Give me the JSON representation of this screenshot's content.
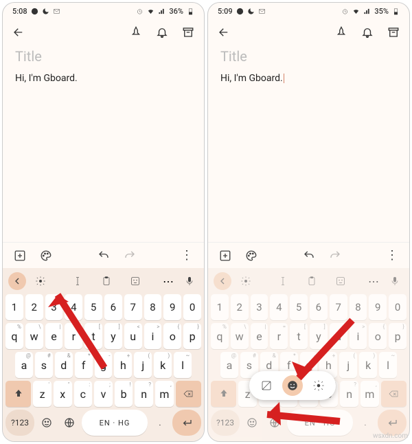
{
  "status": {
    "time_left": "5:08",
    "time_right": "5:09",
    "battery_left": "36%",
    "battery_right": "35%"
  },
  "editor": {
    "title_placeholder": "Title",
    "body": "Hi, I'm Gboard."
  },
  "keyboard": {
    "row_nums": [
      "1",
      "2",
      "3",
      "4",
      "5",
      "6",
      "7",
      "8",
      "9",
      "0"
    ],
    "row1": [
      "q",
      "w",
      "e",
      "r",
      "t",
      "y",
      "u",
      "i",
      "o",
      "p"
    ],
    "row1_sup": [
      "%",
      "\\",
      "|",
      "=",
      "[",
      "]",
      "<",
      ">",
      "{",
      "}"
    ],
    "row2": [
      "a",
      "s",
      "d",
      "f",
      "g",
      "h",
      "j",
      "k",
      "l"
    ],
    "row2_sup": [
      "@",
      "#",
      "&",
      "*",
      "-",
      "+",
      "(",
      ")",
      "~"
    ],
    "row3": [
      "z",
      "x",
      "c",
      "v",
      "b",
      "n",
      "m"
    ],
    "row3_sup": [
      "'",
      "\"",
      ":",
      ";",
      "!",
      "?",
      ","
    ],
    "sym": "?123",
    "space": "EN · HG",
    "dot": "."
  },
  "watermark": "wsxdn.com"
}
